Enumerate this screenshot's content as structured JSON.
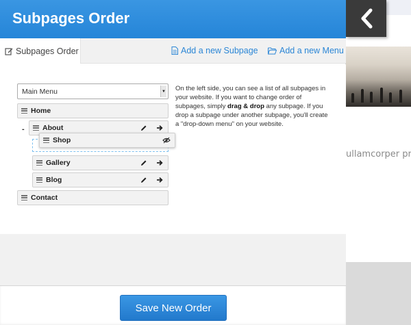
{
  "header": {
    "title": "Subpages Order"
  },
  "tabs": {
    "active_label": "Subpages Order",
    "add_subpage_label": "Add a new Subpage",
    "add_menu_label": "Add a new Menu"
  },
  "menu_select": {
    "value": "Main Menu"
  },
  "items": [
    {
      "label": "Home",
      "level": 0
    },
    {
      "label": "About",
      "level": 0,
      "collapse_symbol": "-"
    },
    {
      "label": "Shop",
      "level": 1,
      "state": "dragging",
      "hidden": true
    },
    {
      "label": "Gallery",
      "level": 1
    },
    {
      "label": "Blog",
      "level": 1
    },
    {
      "label": "Contact",
      "level": 0
    }
  ],
  "help": {
    "part1": "On the left side, you can see a list of all subpages in your website. If you want to change order of subpages, simply ",
    "bold": "drag & drop",
    "part2": " any subpage. If you drop a subpage under another subpage, you'll create a \"drop-down menu\" on your website."
  },
  "footer": {
    "save_label": "Save New Order"
  },
  "background_site": {
    "text": "ullamcorper prim"
  },
  "icons": {
    "tab_active": "edit-icon",
    "add_subpage": "document-icon",
    "add_menu": "folder-icon",
    "edit": "pencil-icon",
    "go": "arrow-right-icon",
    "visibility": "eye-slash-icon",
    "back": "chevron-left-icon",
    "handle": "drag-handle-icon"
  },
  "colors": {
    "accent": "#2585d8",
    "header": "#3a96e2",
    "link": "#2b86d6",
    "back_button": "#3a3a3a"
  }
}
